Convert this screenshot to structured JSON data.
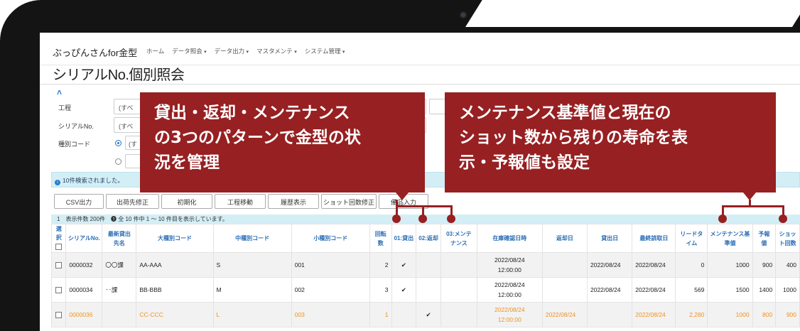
{
  "app": {
    "title": "ぶっぴんさんfor金型"
  },
  "nav": [
    {
      "label": "ホーム"
    },
    {
      "label": "データ照会"
    },
    {
      "label": "データ出力"
    },
    {
      "label": "マスタメンテ"
    },
    {
      "label": "システム管理"
    }
  ],
  "page": {
    "title": "シリアルNo.個別照会"
  },
  "filter": {
    "process_label": "工程",
    "process_value": "(すべ",
    "serial_label": "シリアルNo.",
    "serial_value": "(すべ",
    "type_label": "種別コード",
    "type_value": "(す"
  },
  "info": {
    "text": "10件検索されました。"
  },
  "toolbar": {
    "csv": "CSV出力",
    "dest": "出荷先修正",
    "init": "初期化",
    "move": "工程移動",
    "history": "履歴表示",
    "shot": "ショット回数修正",
    "stock": "備品入力"
  },
  "summary": {
    "text": "1　表示件数 200件　❶ 全 10 件中 1 ～ 10 件目を表示しています。"
  },
  "table": {
    "headers": {
      "select": "選択",
      "serial": "シリアルNo.",
      "dest": "最新貸出先名",
      "large": "大種別コード",
      "middle": "中種別コード",
      "small": "小種別コード",
      "rot": "回転数",
      "p1": "01:貸出",
      "p2": "02:返却",
      "p3": "03:メンテナンス",
      "stock_date": "在庫確認日時",
      "return_date": "返却日",
      "lend_date": "貸出日",
      "last_read": "最終読取日",
      "lead_time": "リードタイム",
      "maint_std": "メンテナンス基準値",
      "forecast": "予報値",
      "shots": "ショット回数"
    },
    "rows": [
      {
        "serial": "0000032",
        "dest": "〇〇課",
        "large": "AA-AAA",
        "middle": "S",
        "small": "001",
        "rot": "2",
        "p1": "✔",
        "p2": "",
        "p3": "",
        "stock_date": "2022/08/24",
        "stock_time": "12:00:00",
        "return_date": "",
        "lend_date": "2022/08/24",
        "last_read": "2022/08/24",
        "lead_time": "0",
        "maint_std": "1000",
        "forecast": "900",
        "shots": "400"
      },
      {
        "serial": "0000034",
        "dest": "‥課",
        "large": "BB-BBB",
        "middle": "M",
        "small": "002",
        "rot": "3",
        "p1": "✔",
        "p2": "",
        "p3": "",
        "stock_date": "2022/08/24",
        "stock_time": "12:00:00",
        "return_date": "",
        "lend_date": "2022/08/24",
        "last_read": "2022/08/24",
        "lead_time": "569",
        "maint_std": "1500",
        "forecast": "1400",
        "shots": "1000"
      },
      {
        "serial": "0000036",
        "dest": "",
        "large": "CC-CCC",
        "middle": "L",
        "small": "003",
        "rot": "1",
        "p1": "",
        "p2": "✔",
        "p3": "",
        "stock_date": "2022/08/24",
        "stock_time": "12:00:00",
        "return_date": "2022/08/24",
        "lend_date": "",
        "last_read": "2022/08/24",
        "lead_time": "2,280",
        "maint_std": "1000",
        "forecast": "800",
        "shots": "900"
      }
    ]
  },
  "callouts": {
    "left": [
      "貸出・返却・メンテナンス",
      "の3つのパターンで金型の状",
      "況を管理"
    ],
    "right": [
      "メンテナンス基準値と現在の",
      "ショット数から残りの寿命を表",
      "示・予報値も設定"
    ]
  },
  "colors": {
    "callout": "#972022",
    "link": "#2a6db5",
    "highlight_row": "#f0921e",
    "info_bg": "#d4eef5"
  }
}
